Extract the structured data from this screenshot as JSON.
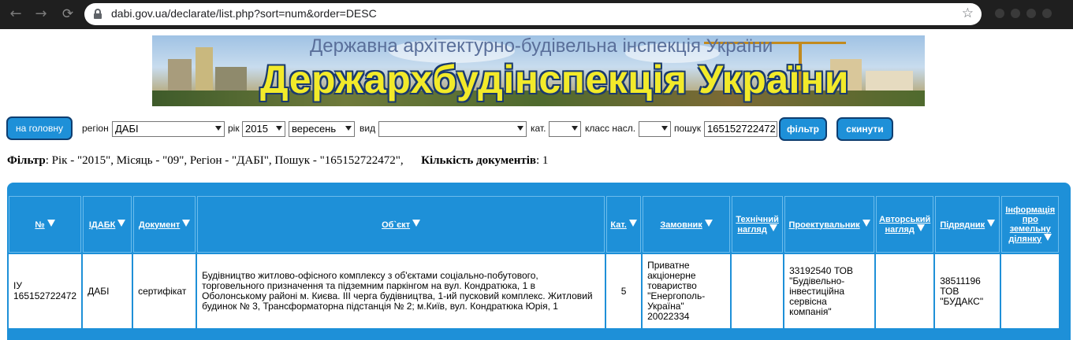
{
  "browser": {
    "url": "dabi.gov.ua/declarate/list.php?sort=num&order=DESC"
  },
  "banner": {
    "subtitle": "Державна архітектурно-будівельна інспекція України",
    "title": "Держархбудінспекція України"
  },
  "filters": {
    "home_label": "на головну",
    "region_label": "регіон",
    "region_value": "ДАБІ",
    "year_label": "рік",
    "year_value": "2015",
    "month_value": "вересень",
    "type_label": "вид",
    "type_value": "",
    "category_label": "кат.",
    "category_value": "",
    "class_label": "класс насл.",
    "class_value": "",
    "search_label": "пошук",
    "search_value": "165152722472",
    "filter_label": "фільтр",
    "reset_label": "скинути"
  },
  "summary": {
    "filter_label": "Фільтр",
    "filter_text": ": Рік - \"2015\", Місяць - \"09\", Регіон - \"ДАБІ\", Пошук - \"165152722472\",",
    "count_label": "Кількість документів",
    "count_text": ": 1"
  },
  "table": {
    "columns": [
      {
        "line1": "№",
        "line2": ""
      },
      {
        "line1": "IДАБК",
        "line2": ""
      },
      {
        "line1": "Документ",
        "line2": ""
      },
      {
        "line1": "Об`єкт",
        "line2": ""
      },
      {
        "line1": "Кат.",
        "line2": ""
      },
      {
        "line1": "Замовник",
        "line2": ""
      },
      {
        "line1": "Технічний",
        "line2": "нагляд"
      },
      {
        "line1": "Проектувальник",
        "line2": ""
      },
      {
        "line1": "Авторський",
        "line2": "нагляд"
      },
      {
        "line1": "Підрядник",
        "line2": ""
      },
      {
        "line1": "Інформація про земельну",
        "line2": "ділянку"
      }
    ],
    "rows": [
      {
        "num": "ІУ 165152722472",
        "dabk": "ДАБІ",
        "document": "сертифікат",
        "object": "Будівництво житлово-офісного комплексу з об'єктами соціально-побутового, торговельного призначення та підземним паркінгом на вул. Кондратюка, 1 в Оболонському районі м. Києва. ІІІ черга будівництва, 1-ий пусковий комплекс. Житловий будинок № 3, Трансформаторна підстанція № 2; м.Київ, вул. Кондратюка Юрія, 1",
        "category": "5",
        "customer": "Приватне акціонерне товариство \"Енергополь-Україна\" 20022334",
        "tech_supervision": "",
        "designer": "33192540 ТОВ \"Будівельно-інвестиційна сервісна компанія\"",
        "author_supervision": "",
        "contractor": "38511196 ТОВ \"БУДАКС\"",
        "land_info": ""
      }
    ]
  }
}
